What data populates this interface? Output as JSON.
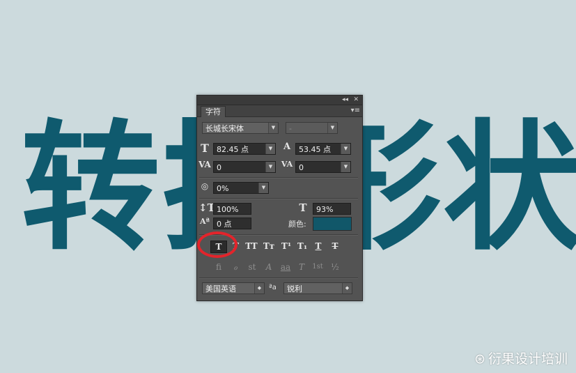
{
  "background": {
    "text": "转换形状",
    "color": "#0f5a6e",
    "bg_color": "#ccdadd"
  },
  "panel": {
    "collapse_icon": "◂◂",
    "close_icon": "✕",
    "tab": "字符",
    "menu_icon": "▾≡",
    "font_family": "长城长宋体",
    "font_style": "-",
    "font_size": "82.45 点",
    "leading": "53.45 点",
    "kerning": "0",
    "tracking": "0",
    "tsume": "0%",
    "vertical_scale": "100%",
    "horizontal_scale": "93%",
    "baseline_shift": "0 点",
    "color_label": "颜色:",
    "color_value": "#115769",
    "style_buttons": [
      "T",
      "T",
      "TT",
      "Tт",
      "T¹",
      "T₁",
      "T",
      "T"
    ],
    "opentype_buttons": [
      "fi",
      "ℴ",
      "st",
      "A",
      "aa",
      "T",
      "1st",
      "½"
    ],
    "language": "美国英语",
    "aa_icon": "ªa",
    "antialias": "锐利"
  },
  "highlight_color": "#e3242b",
  "watermark": {
    "logo": "⊛",
    "text": "衍果设计培训"
  }
}
